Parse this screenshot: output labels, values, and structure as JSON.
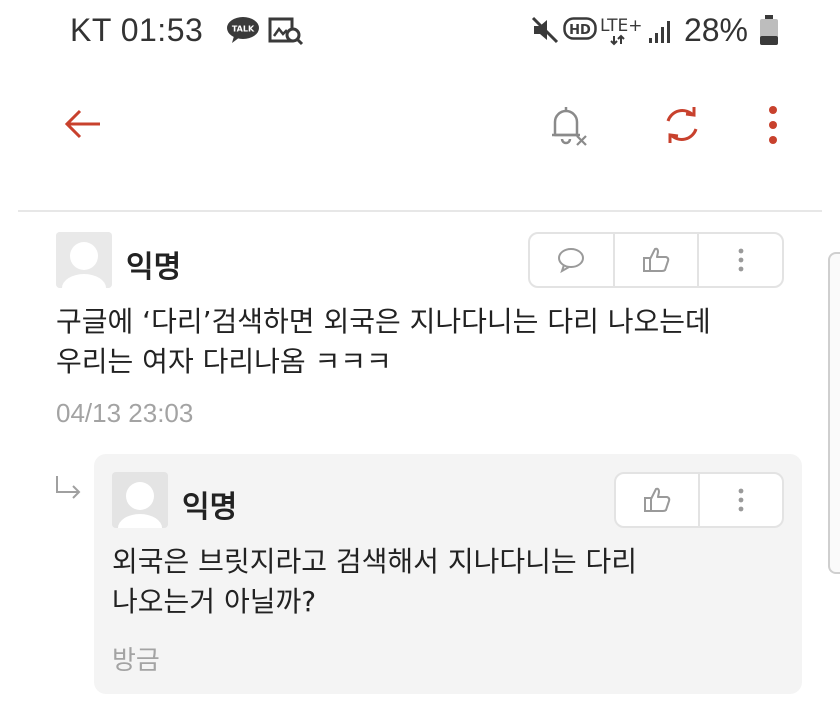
{
  "status_bar": {
    "carrier_time": "KT 01:53",
    "talk_badge": "TALK",
    "network": "LTE+",
    "hd_label": "HD",
    "battery": "28%",
    "icons": [
      "talk-icon",
      "gallery-search-icon",
      "mute-icon",
      "hd-voice-icon",
      "lte-icon",
      "signal-icon",
      "battery-icon"
    ]
  },
  "app_bar": {
    "icons": [
      "back-arrow-icon",
      "notification-off-icon",
      "refresh-icon",
      "more-vertical-icon"
    ]
  },
  "comment": {
    "author": "익명",
    "text_line1": "구글에 ‘다리’검색하면 외국은 지나다니는 다리 나오는데",
    "text_line2": "우리는 여자 다리나옴 ㅋㅋㅋ",
    "timestamp": "04/13 23:03",
    "actions": [
      "reply-icon",
      "like-icon",
      "more-icon"
    ]
  },
  "reply": {
    "author": "익명",
    "text_line1": "외국은 브릿지라고 검색해서 지나다니는 다리",
    "text_line2": "나오는거 아닐까?",
    "timestamp": "방금",
    "actions": [
      "like-icon",
      "more-icon"
    ]
  },
  "colors": {
    "accent": "#c8412d",
    "icon_gray": "#8a8a8a",
    "reply_bg": "#f4f4f4",
    "timestamp_gray": "#a3a3a3"
  }
}
